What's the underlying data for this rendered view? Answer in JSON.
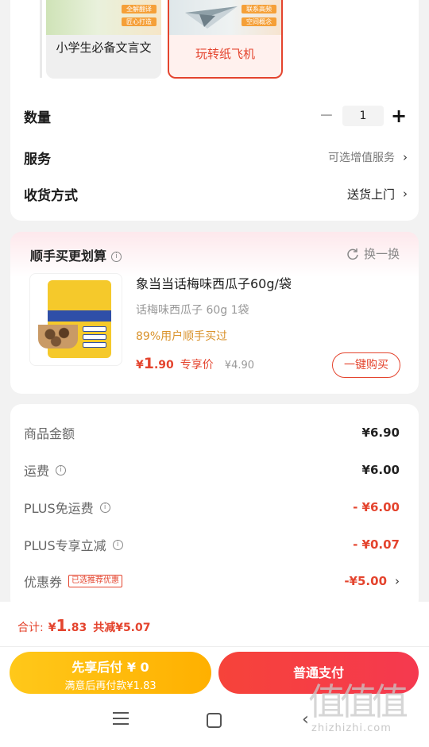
{
  "variants": [
    {
      "label": "小学生必备文言文",
      "tags": [
        "全解翻译",
        "匠心打造"
      ],
      "selected": false
    },
    {
      "label": "玩转纸飞机",
      "tags": [
        "联系高频",
        "空间概念"
      ],
      "selected": true
    }
  ],
  "quantity": {
    "label": "数量",
    "minus": "−",
    "value": "1",
    "plus": "+"
  },
  "service": {
    "label": "服务",
    "value": "可选增值服务"
  },
  "delivery": {
    "label": "收货方式",
    "value": "送货上门"
  },
  "addon": {
    "title": "顺手买更划算",
    "refresh": "换一换",
    "product": {
      "name": "象当当话梅味西瓜子60g/袋",
      "spec": "话梅味西瓜子 60g 1袋",
      "social": "89%用户顺手买过",
      "price_yen": "¥",
      "price_int": "1",
      "price_dec": ".90",
      "price_tag": "专享价",
      "original_price": "¥4.90",
      "buy_label": "一键购买"
    }
  },
  "summary": {
    "goods_amount": {
      "label": "商品金额",
      "value": "¥6.90"
    },
    "shipping": {
      "label": "运费",
      "value": "¥6.00"
    },
    "plus_free_shipping": {
      "label": "PLUS免运费",
      "value": "- ¥6.00"
    },
    "plus_discount": {
      "label": "PLUS专享立减",
      "value": "- ¥0.07"
    },
    "coupon": {
      "label": "优惠券",
      "badge": "已选推荐优惠",
      "value": "-¥5.00"
    }
  },
  "footer": {
    "total_label": "合计:",
    "total_yen": "¥",
    "total_int": "1",
    "total_dec": ".83",
    "total_saved": "共减¥5.07",
    "pay_later_main": "先享后付 ¥ 0",
    "pay_later_sub": "满意后再付款¥1.83",
    "pay_normal": "普通支付"
  },
  "watermark": {
    "big": "值值值",
    "small": "zhizhizhi.com"
  },
  "colors": {
    "accent": "#e4442e",
    "pay_later": "#ffbe0f",
    "pay_normal": "#f5394f",
    "social": "#d9922b"
  }
}
